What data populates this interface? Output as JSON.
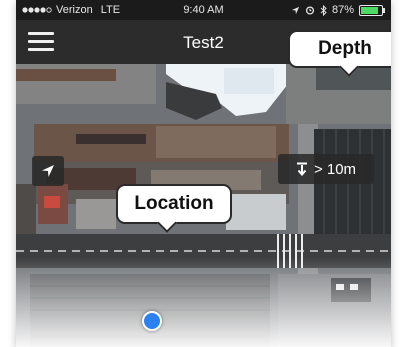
{
  "status_bar": {
    "carrier": "Verizon",
    "network": "LTE",
    "time": "9:40 AM",
    "battery_percent": "87%",
    "battery_level": 0.87,
    "icons": [
      "signal-dots-icon",
      "location-arrow-icon",
      "alarm-icon",
      "bluetooth-icon",
      "battery-icon"
    ]
  },
  "nav_bar": {
    "title": "Test2",
    "menu_icon": "hamburger-menu-icon"
  },
  "map": {
    "type": "aerial-satellite",
    "locate_button_icon": "location-arrow-icon",
    "depth_button": {
      "icon": "depth-arrow-down-icon",
      "label": "> 10m"
    }
  },
  "callouts": {
    "depth": "Depth",
    "location": "Location"
  },
  "colors": {
    "nav_background": "#2c2c2c",
    "location_dot": "#2a82f2",
    "battery_fill": "#4cd964"
  }
}
